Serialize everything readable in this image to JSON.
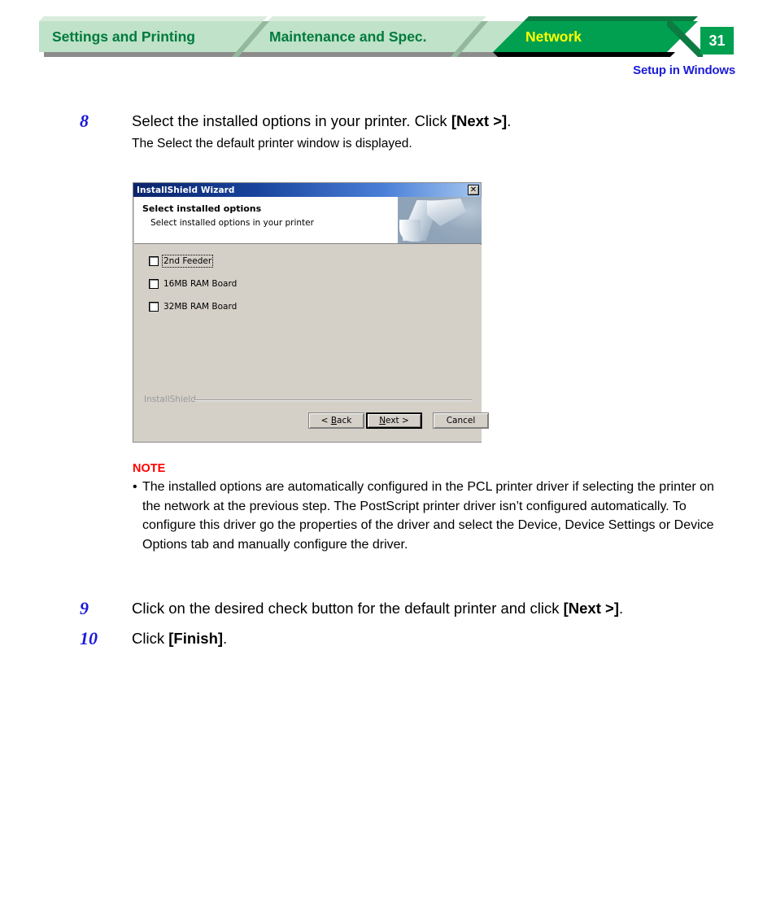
{
  "banner": {
    "tabs": [
      {
        "label": "Settings and Printing",
        "state": "inactive"
      },
      {
        "label": "Maintenance and Spec.",
        "state": "inactive"
      },
      {
        "label": "Network",
        "state": "active"
      }
    ],
    "page_number": "31",
    "subtitle": "Setup in Windows",
    "colors": {
      "tab_inactive_bg": "#bfe2c8",
      "tab_inactive_text": "#007a3d",
      "tab_active_bg": "#00a050",
      "tab_active_text": "#ffff00",
      "page_box_bg": "#00a050",
      "subtitle_text": "#1b1bd8"
    }
  },
  "steps": [
    {
      "number": "8",
      "text_plain": "Select the installed options in your printer. Click ",
      "text_bold": "[Next >]",
      "text_tail": ".",
      "subtext": "The Select the default printer window is displayed."
    },
    {
      "number": "9",
      "text_plain": "Click on the desired check button for the default printer and click ",
      "text_bold": "[Next >]",
      "text_tail": "."
    },
    {
      "number": "10",
      "text_plain": "Click ",
      "text_bold": "[Finish]",
      "text_tail": "."
    }
  ],
  "dialog": {
    "title": "InstallShield Wizard",
    "close_icon": "close-x-icon",
    "header_title": "Select installed options",
    "header_subtitle": "Select installed options in your printer",
    "options": [
      {
        "label": "2nd Feeder",
        "checked": false,
        "focused": true
      },
      {
        "label": "16MB RAM Board",
        "checked": false,
        "focused": false
      },
      {
        "label": "32MB RAM Board",
        "checked": false,
        "focused": false
      }
    ],
    "brand": "InstallShield",
    "buttons": {
      "back": "< Back",
      "back_pre": "< ",
      "back_accel": "B",
      "back_post": "ack",
      "next_pre": "",
      "next_accel": "N",
      "next_post": "ext >",
      "cancel": "Cancel"
    }
  },
  "note": {
    "heading": "NOTE",
    "bullet": "•",
    "text": "The installed options are automatically configured in the PCL printer driver if selecting the printer on the network at the previous step.  The PostScript printer driver isn’t configured automatically.  To configure this driver go the properties of the driver and select the Device, Device Settings or Device Options tab and manually configure the driver."
  }
}
